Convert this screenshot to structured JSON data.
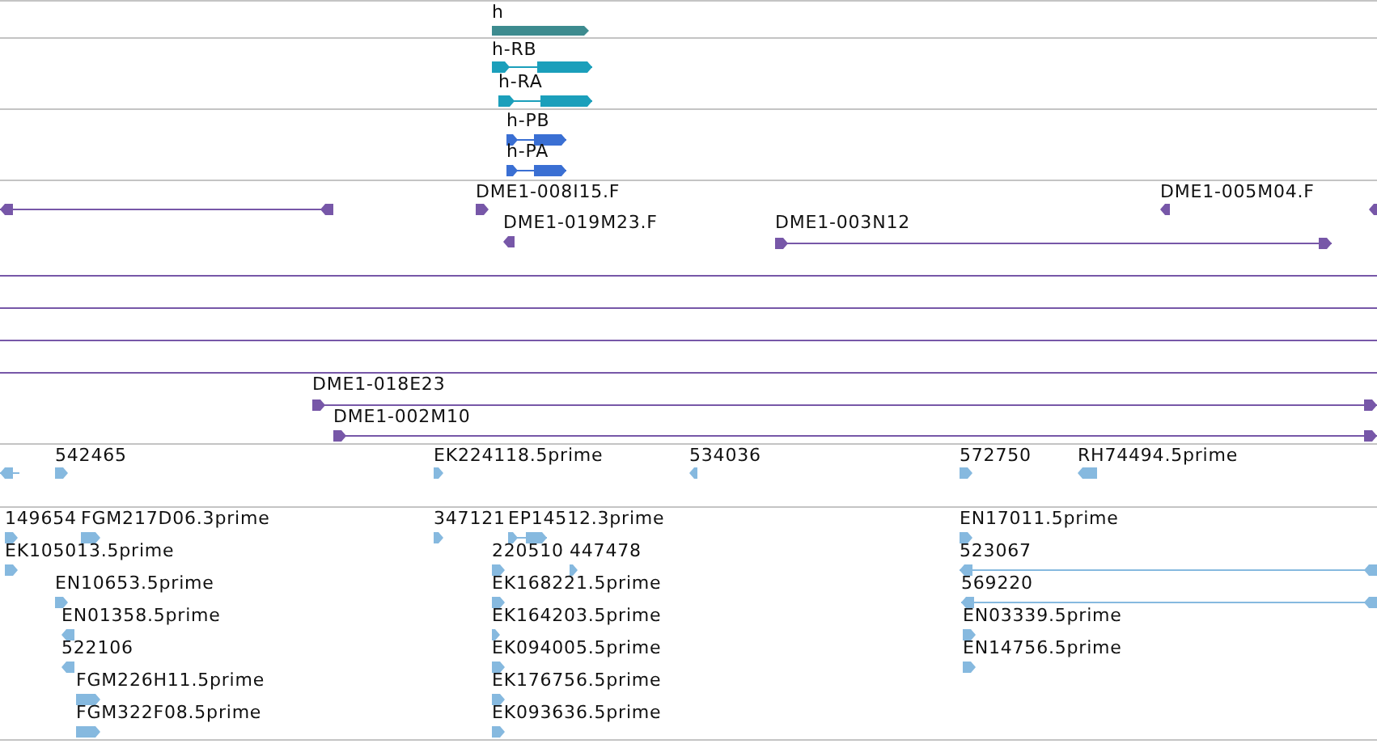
{
  "tracks": [
    {
      "color": "#3d8b8f",
      "features": [
        {
          "label": "h",
          "kind": "gene",
          "forward": true
        }
      ]
    },
    {
      "color": "#1b9fbb",
      "features": [
        {
          "label": "h-RB",
          "kind": "transcript",
          "forward": true
        },
        {
          "label": "h-RA",
          "kind": "transcript",
          "forward": true
        }
      ]
    },
    {
      "color": "#3a6fd3",
      "features": [
        {
          "label": "h-PB",
          "kind": "transcript",
          "forward": true
        },
        {
          "label": "h-PA",
          "kind": "transcript",
          "forward": true
        }
      ]
    },
    {
      "color": "#7757a8",
      "features": [
        {
          "kind": "span",
          "forward": false
        },
        {
          "label": "DME1-008I15.F",
          "kind": "match",
          "forward": true
        },
        {
          "label": "DME1-019M23.F",
          "kind": "match",
          "forward": false
        },
        {
          "label": "DME1-003N12",
          "kind": "span",
          "forward": true
        },
        {
          "label": "DME1-005M04.F",
          "kind": "match",
          "forward": false
        },
        {
          "kind": "match",
          "forward": false
        },
        {
          "kind": "line"
        },
        {
          "kind": "line"
        },
        {
          "kind": "line"
        },
        {
          "kind": "line"
        },
        {
          "label": "DME1-018E23",
          "kind": "span",
          "forward": true
        },
        {
          "label": "DME1-002M10",
          "kind": "span",
          "forward": true
        }
      ]
    },
    {
      "color": "#86b9df",
      "features": [
        {
          "kind": "span",
          "forward": false
        },
        {
          "label": "542465",
          "kind": "match",
          "forward": true
        },
        {
          "label": "EK224118.5prime",
          "kind": "match",
          "forward": true
        },
        {
          "label": "534036",
          "kind": "match",
          "forward": false
        },
        {
          "label": "572750",
          "kind": "match",
          "forward": true
        },
        {
          "label": "RH74494.5prime",
          "kind": "match",
          "forward": false
        }
      ]
    },
    {
      "color": "#86b9df",
      "features": [
        {
          "label": "149654",
          "kind": "match",
          "forward": true
        },
        {
          "label": "FGM217D06.3prime",
          "kind": "match",
          "forward": true
        },
        {
          "label": "EK105013.5prime",
          "kind": "match",
          "forward": true
        },
        {
          "label": "EN10653.5prime",
          "kind": "match",
          "forward": true
        },
        {
          "label": "EN01358.5prime",
          "kind": "match",
          "forward": false
        },
        {
          "label": "522106",
          "kind": "match",
          "forward": false
        },
        {
          "label": "FGM226H11.5prime",
          "kind": "match",
          "forward": true
        },
        {
          "label": "FGM322F08.5prime",
          "kind": "match",
          "forward": true
        },
        {
          "label": "347121",
          "kind": "match",
          "forward": true
        },
        {
          "label": "EP14512.3prime",
          "kind": "transcript",
          "forward": true
        },
        {
          "label": "220510",
          "kind": "match",
          "forward": true
        },
        {
          "label": "447478",
          "kind": "match",
          "forward": true
        },
        {
          "label": "EK168221.5prime",
          "kind": "match",
          "forward": true
        },
        {
          "label": "EK164203.5prime",
          "kind": "match",
          "forward": true
        },
        {
          "label": "EK094005.5prime",
          "kind": "match",
          "forward": true
        },
        {
          "label": "EK176756.5prime",
          "kind": "match",
          "forward": true
        },
        {
          "label": "EK093636.5prime",
          "kind": "match",
          "forward": true
        },
        {
          "label": "EN17011.5prime",
          "kind": "match",
          "forward": true
        },
        {
          "label": "523067",
          "kind": "span",
          "forward": false
        },
        {
          "label": "569220",
          "kind": "span",
          "forward": false
        },
        {
          "label": "EN03339.5prime",
          "kind": "match",
          "forward": true
        },
        {
          "label": "EN14756.5prime",
          "kind": "match",
          "forward": true
        }
      ]
    }
  ]
}
